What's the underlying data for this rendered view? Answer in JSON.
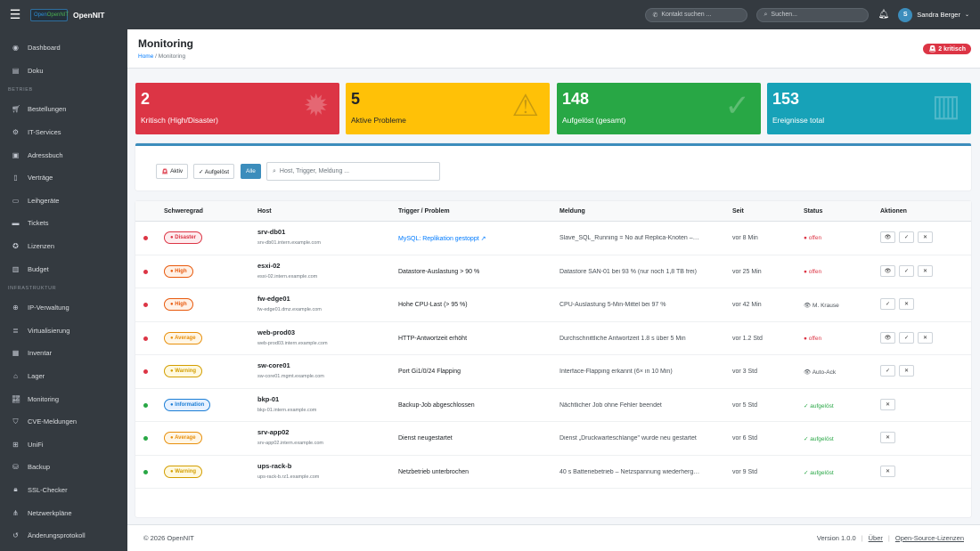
{
  "topbar": {
    "menu_icon": "hamburger-icon",
    "logo_text": "OpenNIT",
    "app_name": "OpenNIT",
    "contact_placeholder": "Kontakt suchen ...",
    "search_placeholder": "Suchen...",
    "user_initial": "S",
    "user_name": "Sandra Berger"
  },
  "sidebar": {
    "items_top": [
      {
        "label": "Dashboard",
        "icon": "dashboard-icon"
      },
      {
        "label": "Doku",
        "icon": "book-icon"
      }
    ],
    "section_betrieb": "BETRIEB",
    "items_betrieb": [
      {
        "label": "Bestellungen",
        "icon": "cart-icon"
      },
      {
        "label": "IT-Services",
        "icon": "gear-icon"
      },
      {
        "label": "Adressbuch",
        "icon": "addressbook-icon"
      },
      {
        "label": "Verträge",
        "icon": "document-icon"
      },
      {
        "label": "Leihgeräte",
        "icon": "laptop-icon"
      },
      {
        "label": "Tickets",
        "icon": "ticket-icon"
      },
      {
        "label": "Lizenzen",
        "icon": "license-icon"
      },
      {
        "label": "Budget",
        "icon": "budget-icon"
      }
    ],
    "section_infra": "INFRASTRUKTUR",
    "items_infra": [
      {
        "label": "IP-Verwaltung",
        "icon": "network-icon"
      },
      {
        "label": "Virtualisierung",
        "icon": "server-icon"
      },
      {
        "label": "Inventar",
        "icon": "inventory-icon"
      },
      {
        "label": "Lager",
        "icon": "warehouse-icon"
      },
      {
        "label": "Monitoring",
        "icon": "chart-icon"
      },
      {
        "label": "CVE-Meldungen",
        "icon": "shield-icon"
      },
      {
        "label": "UniFi",
        "icon": "sitemap-icon"
      },
      {
        "label": "Backup",
        "icon": "database-icon"
      },
      {
        "label": "SSL-Checker",
        "icon": "lock-icon"
      },
      {
        "label": "Netzwerkpläne",
        "icon": "diagram-icon"
      },
      {
        "label": "Änderungsprotokoll",
        "icon": "history-icon"
      }
    ]
  },
  "page": {
    "title": "Monitoring",
    "breadcrumb_home": "Home",
    "breadcrumb_sep": "/",
    "breadcrumb_current": "Monitoring",
    "crit_badge": "2 kritisch"
  },
  "cards": [
    {
      "value": "2",
      "label": "Kritisch (High/Disaster)",
      "color": "#dc3545",
      "icon": "siren-icon"
    },
    {
      "value": "5",
      "label": "Aktive Probleme",
      "color": "#ffc107",
      "icon": "warning-icon"
    },
    {
      "value": "148",
      "label": "Aufgelöst (gesamt)",
      "color": "#28a745",
      "icon": "check-icon"
    },
    {
      "value": "153",
      "label": "Ereignisse total",
      "color": "#17a2b8",
      "icon": "bar-chart-icon"
    }
  ],
  "filters": {
    "aktiv": "Aktiv",
    "aufgeloest": "✓ Aufgelöst",
    "alle": "Alle",
    "search_placeholder": "Host, Trigger, Meldung ..."
  },
  "table": {
    "headers": [
      "Schweregrad",
      "Host",
      "Trigger / Problem",
      "Meldung",
      "Seit",
      "Status",
      "Aktionen"
    ],
    "rows": [
      {
        "dot": "#dc3545",
        "sev": "● Disaster",
        "sev_color": "#dc3545",
        "sev_bg": "#fdecee",
        "host": "srv-db01",
        "fqdn": "srv-db01.intern.example.com",
        "trigger": "MySQL: Replikation gestoppt ↗",
        "trigger_link": true,
        "msg": "Slave_SQL_Running = No auf Replica-Knoten –…",
        "seit": "vor 8 Min",
        "status": "● offen",
        "status_color": "#dc3545",
        "actions": [
          "eye",
          "check",
          "close"
        ]
      },
      {
        "dot": "#dc3545",
        "sev": "● High",
        "sev_color": "#e8590c",
        "sev_bg": "#fff1e6",
        "host": "esxi-02",
        "fqdn": "esxi-02.intern.example.com",
        "trigger": "Datastore-Auslastung > 90 %",
        "trigger_link": false,
        "msg": "Datastore SAN-01 bei 93 % (nur noch 1,8 TB frei)",
        "seit": "vor 25 Min",
        "status": "● offen",
        "status_color": "#dc3545",
        "actions": [
          "eye",
          "check",
          "close"
        ]
      },
      {
        "dot": "#dc3545",
        "sev": "● High",
        "sev_color": "#e8590c",
        "sev_bg": "#fff1e6",
        "host": "fw-edge01",
        "fqdn": "fw-edge01.dmz.example.com",
        "trigger": "Hohe CPU-Last (> 95 %)",
        "trigger_link": false,
        "msg": "CPU-Auslastung 5-Min-Mittel bei 97 %",
        "seit": "vor 42 Min",
        "status": "👁 M. Krause",
        "status_color": "#495057",
        "actions": [
          "check",
          "close"
        ]
      },
      {
        "dot": "#dc3545",
        "sev": "● Average",
        "sev_color": "#e8900c",
        "sev_bg": "#fff6e6",
        "host": "web-prod03",
        "fqdn": "web-prod03.intern.example.com",
        "trigger": "HTTP-Antwortzeit erhöht",
        "trigger_link": false,
        "msg": "Durchschnittliche Antwortzeit 1.8 s über 5 Min",
        "seit": "vor 1.2 Std",
        "status": "● offen",
        "status_color": "#dc3545",
        "actions": [
          "eye",
          "check",
          "close"
        ]
      },
      {
        "dot": "#dc3545",
        "sev": "● Warning",
        "sev_color": "#d39e00",
        "sev_bg": "#fff9e0",
        "host": "sw-core01",
        "fqdn": "sw-core01.mgmt.example.com",
        "trigger": "Port Gi1/0/24 Flapping",
        "trigger_link": false,
        "msg": "Interface-Flapping erkannt (6× in 10 Min)",
        "seit": "vor 3 Std",
        "status": "👁 Auto-Ack",
        "status_color": "#495057",
        "actions": [
          "check",
          "close"
        ]
      },
      {
        "dot": "#28a745",
        "sev": "● Information",
        "sev_color": "#1c7ed6",
        "sev_bg": "#e7f1ff",
        "host": "bkp-01",
        "fqdn": "bkp-01.intern.example.com",
        "trigger": "Backup-Job abgeschlossen",
        "trigger_link": false,
        "msg": "Nächtlicher Job ohne Fehler beendet",
        "seit": "vor 5 Std",
        "status": "✓ aufgelöst",
        "status_color": "#28a745",
        "actions": [
          "close"
        ]
      },
      {
        "dot": "#28a745",
        "sev": "● Average",
        "sev_color": "#e8900c",
        "sev_bg": "#fff6e6",
        "host": "srv-app02",
        "fqdn": "srv-app02.intern.example.com",
        "trigger": "Dienst neugestartet",
        "trigger_link": false,
        "msg": "Dienst „Druckwarteschlange\" wurde neu gestartet",
        "seit": "vor 6 Std",
        "status": "✓ aufgelöst",
        "status_color": "#28a745",
        "actions": [
          "close"
        ]
      },
      {
        "dot": "#28a745",
        "sev": "● Warning",
        "sev_color": "#d39e00",
        "sev_bg": "#fff9e0",
        "host": "ups-rack-b",
        "fqdn": "ups-rack-b.rz1.example.com",
        "trigger": "Netzbetrieb unterbrochen",
        "trigger_link": false,
        "msg": "40 s Batteriebetrieb – Netzspannung wiederherg…",
        "seit": "vor 9 Std",
        "status": "✓ aufgelöst",
        "status_color": "#28a745",
        "actions": [
          "close"
        ]
      }
    ]
  },
  "footer": {
    "copyright": "© 2026 OpenNIT",
    "version": "Version 1.0.0",
    "about": "Über",
    "licenses": "Open-Source-Lizenzen"
  }
}
